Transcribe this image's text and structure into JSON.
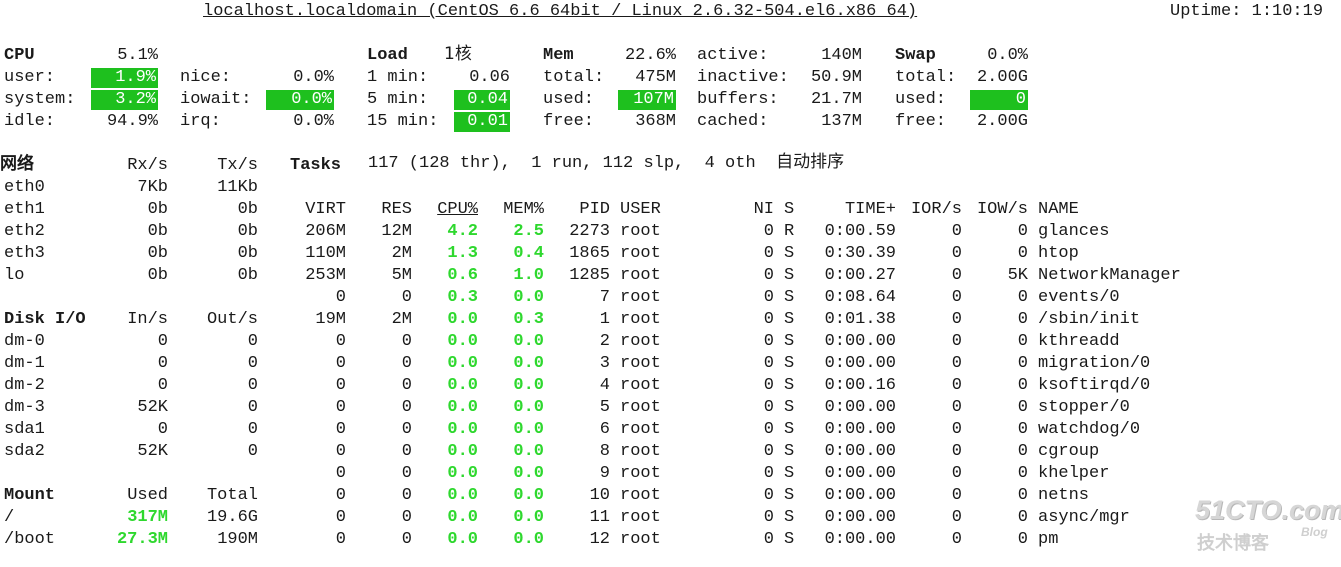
{
  "header": {
    "title": "localhost.localdomain (CentOS 6.6 64bit / Linux 2.6.32-504.el6.x86 64)",
    "uptime": "Uptime: 1:10:19"
  },
  "cpu": {
    "label": "CPU",
    "total": "5.1%",
    "user_l": "user:",
    "user": "1.9%",
    "system_l": "system:",
    "system": "3.2%",
    "idle_l": "idle:",
    "idle": "94.9%",
    "nice_l": "nice:",
    "nice": "0.0%",
    "iowait_l": "iowait:",
    "iowait": "0.0%",
    "irq_l": "irq:",
    "irq": "0.0%"
  },
  "load": {
    "label": "Load",
    "cores": "1核",
    "m1_l": "1 min:",
    "m1": "0.06",
    "m5_l": "5 min:",
    "m5": "0.04",
    "m15_l": "15 min:",
    "m15": "0.01"
  },
  "mem": {
    "label": "Mem",
    "pct": "22.6%",
    "total_l": "total:",
    "total": "475M",
    "used_l": "used:",
    "used": "107M",
    "free_l": "free:",
    "free": "368M",
    "active_l": "active:",
    "active": "140M",
    "inactive_l": "inactive:",
    "inactive": "50.9M",
    "buffers_l": "buffers:",
    "buffers": "21.7M",
    "cached_l": "cached:",
    "cached": "137M"
  },
  "swap": {
    "label": "Swap",
    "pct": "0.0%",
    "total_l": "total:",
    "total": "2.00G",
    "used_l": "used:",
    "used": "0",
    "free_l": "free:",
    "free": "2.00G"
  },
  "network": {
    "label": "网络",
    "rx": "Rx/s",
    "tx": "Tx/s",
    "rows": [
      [
        "eth0",
        "7Kb",
        "11Kb"
      ],
      [
        "eth1",
        "0b",
        "0b"
      ],
      [
        "eth2",
        "0b",
        "0b"
      ],
      [
        "eth3",
        "0b",
        "0b"
      ],
      [
        "lo",
        "0b",
        "0b"
      ]
    ]
  },
  "tasks": {
    "label": "Tasks",
    "summary": "117 (128 thr),  1 run, 112 slp,  4 oth  自动排序"
  },
  "disk": {
    "label": "Disk I/O",
    "in": "In/s",
    "out": "Out/s",
    "rows": [
      [
        "dm-0",
        "0",
        "0"
      ],
      [
        "dm-1",
        "0",
        "0"
      ],
      [
        "dm-2",
        "0",
        "0"
      ],
      [
        "dm-3",
        "52K",
        "0"
      ],
      [
        "sda1",
        "0",
        "0"
      ],
      [
        "sda2",
        "52K",
        "0"
      ]
    ]
  },
  "mount": {
    "label": "Mount",
    "used": "Used",
    "total": "Total",
    "rows": [
      [
        "/",
        "317M",
        "19.6G"
      ],
      [
        "/boot",
        "27.3M",
        "190M"
      ]
    ]
  },
  "process": {
    "headers": {
      "virt": "VIRT",
      "res": "RES",
      "cpu": "CPU%",
      "mem": "MEM%",
      "pid": "PID",
      "user": "USER",
      "ni": "NI",
      "s": "S",
      "time": "TIME+",
      "ior": "IOR/s",
      "iow": "IOW/s",
      "name": "NAME"
    },
    "rows": [
      [
        "206M",
        "12M",
        "4.2",
        "2.5",
        "2273",
        "root",
        "0",
        "R",
        "0:00.59",
        "0",
        "0",
        "glances"
      ],
      [
        "110M",
        "2M",
        "1.3",
        "0.4",
        "1865",
        "root",
        "0",
        "S",
        "0:30.39",
        "0",
        "0",
        "htop"
      ],
      [
        "253M",
        "5M",
        "0.6",
        "1.0",
        "1285",
        "root",
        "0",
        "S",
        "0:00.27",
        "0",
        "5K",
        "NetworkManager"
      ],
      [
        "0",
        "0",
        "0.3",
        "0.0",
        "7",
        "root",
        "0",
        "S",
        "0:08.64",
        "0",
        "0",
        "events/0"
      ],
      [
        "19M",
        "2M",
        "0.0",
        "0.3",
        "1",
        "root",
        "0",
        "S",
        "0:01.38",
        "0",
        "0",
        "/sbin/init"
      ],
      [
        "0",
        "0",
        "0.0",
        "0.0",
        "2",
        "root",
        "0",
        "S",
        "0:00.00",
        "0",
        "0",
        "kthreadd"
      ],
      [
        "0",
        "0",
        "0.0",
        "0.0",
        "3",
        "root",
        "0",
        "S",
        "0:00.00",
        "0",
        "0",
        "migration/0"
      ],
      [
        "0",
        "0",
        "0.0",
        "0.0",
        "4",
        "root",
        "0",
        "S",
        "0:00.16",
        "0",
        "0",
        "ksoftirqd/0"
      ],
      [
        "0",
        "0",
        "0.0",
        "0.0",
        "5",
        "root",
        "0",
        "S",
        "0:00.00",
        "0",
        "0",
        "stopper/0"
      ],
      [
        "0",
        "0",
        "0.0",
        "0.0",
        "6",
        "root",
        "0",
        "S",
        "0:00.00",
        "0",
        "0",
        "watchdog/0"
      ],
      [
        "0",
        "0",
        "0.0",
        "0.0",
        "8",
        "root",
        "0",
        "S",
        "0:00.00",
        "0",
        "0",
        "cgroup"
      ],
      [
        "0",
        "0",
        "0.0",
        "0.0",
        "9",
        "root",
        "0",
        "S",
        "0:00.00",
        "0",
        "0",
        "khelper"
      ],
      [
        "0",
        "0",
        "0.0",
        "0.0",
        "10",
        "root",
        "0",
        "S",
        "0:00.00",
        "0",
        "0",
        "netns"
      ],
      [
        "0",
        "0",
        "0.0",
        "0.0",
        "11",
        "root",
        "0",
        "S",
        "0:00.00",
        "0",
        "0",
        "async/mgr"
      ],
      [
        "0",
        "0",
        "0.0",
        "0.0",
        "12",
        "root",
        "0",
        "S",
        "0:00.00",
        "0",
        "0",
        "pm"
      ]
    ]
  },
  "watermark": {
    "top": "51CTO.com",
    "bottom": "技术博客",
    "blog": "Blog"
  },
  "colors": {
    "highlight": "#1ec01e",
    "green_text": "#2ed82e",
    "text": "#1a1a1a",
    "background": "#ffffff"
  }
}
